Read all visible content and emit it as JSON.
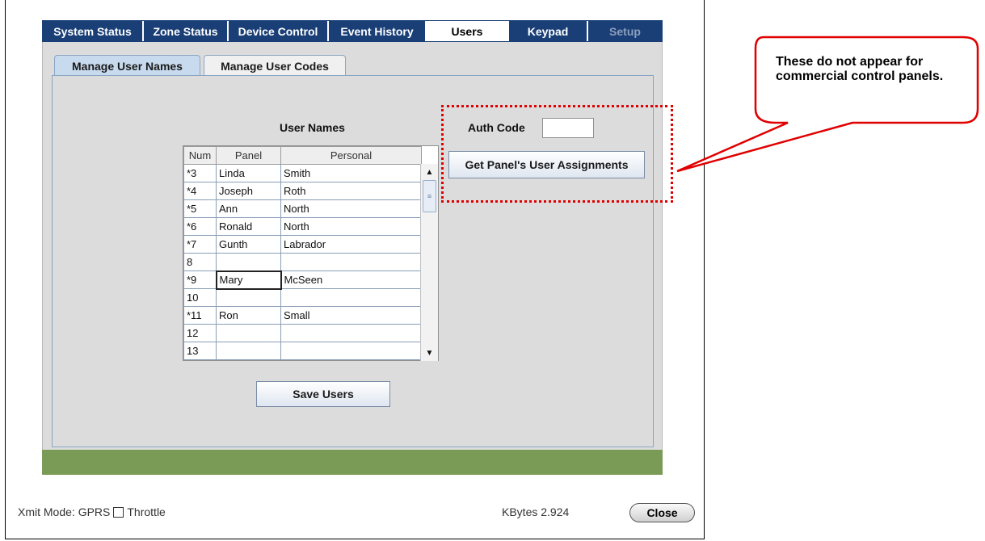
{
  "top_tabs": [
    {
      "label": "System Status",
      "state": "normal"
    },
    {
      "label": "Zone Status",
      "state": "normal"
    },
    {
      "label": "Device Control",
      "state": "normal"
    },
    {
      "label": "Event History",
      "state": "normal"
    },
    {
      "label": "Users",
      "state": "active"
    },
    {
      "label": "Keypad",
      "state": "normal"
    },
    {
      "label": "Setup",
      "state": "disabled"
    }
  ],
  "sub_tabs": [
    {
      "label": "Manage User Names",
      "state": "active"
    },
    {
      "label": "Manage User Codes",
      "state": "inactive"
    }
  ],
  "user_names": {
    "title": "User Names",
    "headers": [
      "Num",
      "Panel",
      "Personal"
    ],
    "rows": [
      {
        "num": "*3",
        "panel": "Linda",
        "personal": "Smith"
      },
      {
        "num": "*4",
        "panel": "Joseph",
        "personal": "Roth"
      },
      {
        "num": "*5",
        "panel": "Ann",
        "personal": "North"
      },
      {
        "num": "*6",
        "panel": "Ronald",
        "personal": "North"
      },
      {
        "num": "*7",
        "panel": "Gunth",
        "personal": "Labrador"
      },
      {
        "num": "8",
        "panel": "",
        "personal": ""
      },
      {
        "num": "*9",
        "panel": "Mary",
        "personal": "McSeen"
      },
      {
        "num": "10",
        "panel": "",
        "personal": ""
      },
      {
        "num": "*11",
        "panel": "Ron",
        "personal": "Small"
      },
      {
        "num": "12",
        "panel": "",
        "personal": ""
      },
      {
        "num": "13",
        "panel": "",
        "personal": ""
      }
    ],
    "selected_row": 6,
    "save_label": "Save Users"
  },
  "auth": {
    "label": "Auth Code",
    "value": "",
    "get_assignments_label": "Get Panel's User Assignments"
  },
  "status_bar": {
    "xmit_mode": "Xmit Mode: GPRS",
    "throttle_label": "Throttle",
    "throttle_checked": false,
    "kbytes": "KBytes  2.924",
    "close_label": "Close"
  },
  "callout": {
    "text": "These do not appear for commercial control panels.",
    "color": "#e00000"
  },
  "colors": {
    "nav_bg": "#1a3f77",
    "status_green": "#7a9b55",
    "callout_red": "#e00000"
  }
}
